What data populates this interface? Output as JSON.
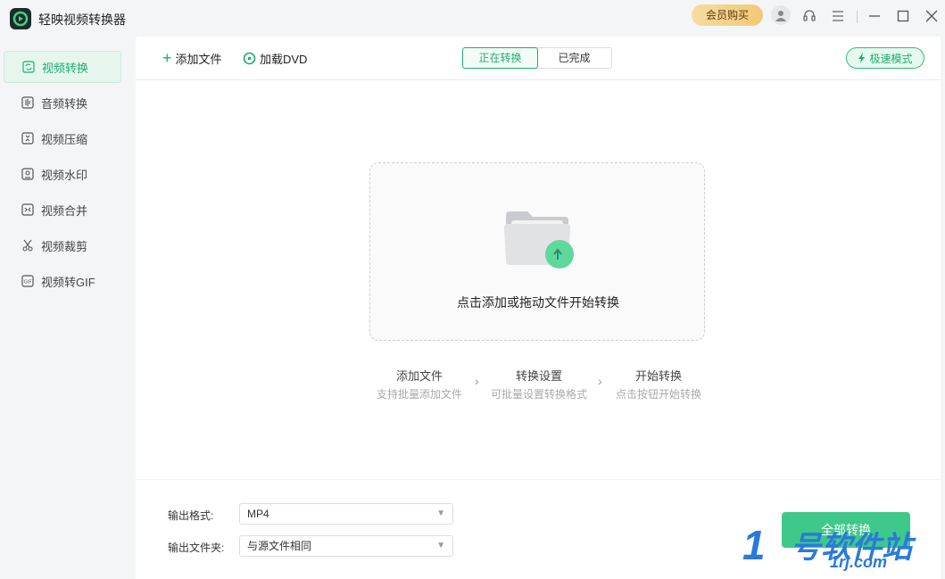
{
  "app": {
    "title": "轻映视频转换器"
  },
  "titlebar": {
    "vip_label": "会员购买"
  },
  "sidebar": {
    "items": [
      {
        "label": "视频转换",
        "icon": "video-convert-icon"
      },
      {
        "label": "音频转换",
        "icon": "audio-convert-icon"
      },
      {
        "label": "视频压缩",
        "icon": "video-compress-icon"
      },
      {
        "label": "视频水印",
        "icon": "video-watermark-icon"
      },
      {
        "label": "视频合并",
        "icon": "video-merge-icon"
      },
      {
        "label": "视频裁剪",
        "icon": "scissors-icon"
      },
      {
        "label": "视频转GIF",
        "icon": "gif-icon"
      }
    ]
  },
  "toolbar": {
    "add_file": "添加文件",
    "load_dvd": "加载DVD",
    "tab_converting": "正在转换",
    "tab_done": "已完成",
    "turbo": "极速模式"
  },
  "dropzone": {
    "text": "点击添加或拖动文件开始转换"
  },
  "steps": [
    {
      "title": "添加文件",
      "desc": "支持批量添加文件"
    },
    {
      "title": "转换设置",
      "desc": "可批量设置转换格式"
    },
    {
      "title": "开始转换",
      "desc": "点击按钮开始转换"
    }
  ],
  "bottom": {
    "format_label": "输出格式:",
    "format_value": "MP4",
    "folder_label": "输出文件夹:",
    "folder_value": "与源文件相同",
    "start_label": "全部转换"
  },
  "watermark": {
    "text": "1号软件站",
    "sub": "1rj.com"
  },
  "colors": {
    "accent": "#1fae6f",
    "vip": "#f2c877"
  }
}
